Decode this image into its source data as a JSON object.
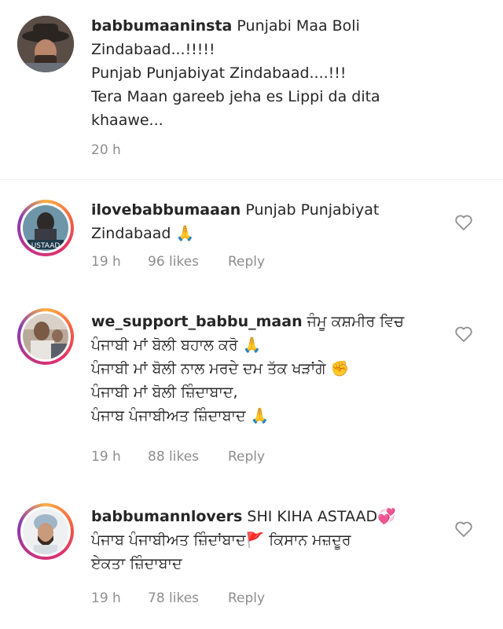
{
  "comments": [
    {
      "username": "babbumaaninsta",
      "lines": [
        "Punjabi Maa Boli",
        "Zindabaad...!!!!!",
        "Punjab Punjabiyat Zindabaad....!!!",
        "Tera Maan gareeb jeha es Lippi da dita",
        "khaawe..."
      ],
      "time": "20 h",
      "avatar_icon": "cowboy-hat-avatar"
    },
    {
      "username": "ilovebabbumaaan",
      "lines": [
        "Punjab Punjabiyat",
        "Zindabaad 🙏"
      ],
      "time": "19 h",
      "likes": "96 likes",
      "reply": "Reply",
      "avatar_icon": "ustaad-poster-avatar",
      "avatar_text": "USTAAD"
    },
    {
      "username": "we_support_babbu_maan",
      "lines": [
        "ਜੰਮੂ ਕਸ਼ਮੀਰ ਵਿਚ",
        "ਪੰਜਾਬੀ ਮਾਂ ਬੋਲੀ ਬਹਾਲ ਕਰੋ 🙏",
        "ਪੰਜਾਬੀ ਮਾਂ ਬੋਲੀ ਨਾਲ ਮਰਦੇ ਦਮ ਤੱਕ ਖੜਾਂਗੇ ✊",
        "ਪੰਜਾਬੀ ਮਾਂ ਬੋਲੀ ਜ਼ਿੰਦਾਬਾਦ,",
        "ਪੰਜਾਬ ਪੰਜਾਬੀਅਤ ਜ਼ਿੰਦਾਬਾਦ 🙏"
      ],
      "time": "19 h",
      "likes": "88 likes",
      "reply": "Reply",
      "avatar_icon": "person-photo-avatar"
    },
    {
      "username": "babbumannlovers",
      "lines": [
        "SHI KIHA ASTAAD💞",
        "ਪੰਜਾਬ ਪੰਜਾਬੀਅਤ ਜ਼ਿੰਦਾਂਬਾਦ🚩 ਕਿਸਾਨ ਮਜ਼ਦੂਰ",
        "ਏਕਤਾ ਜ਼ਿੰਦਾਬਾਦ"
      ],
      "time": "19 h",
      "likes": "78 likes",
      "reply": "Reply",
      "avatar_icon": "turban-avatar"
    }
  ],
  "colors": {
    "text": "#262626",
    "meta": "#8e8e8e"
  },
  "icons": {
    "like": "heart-outline-icon"
  }
}
